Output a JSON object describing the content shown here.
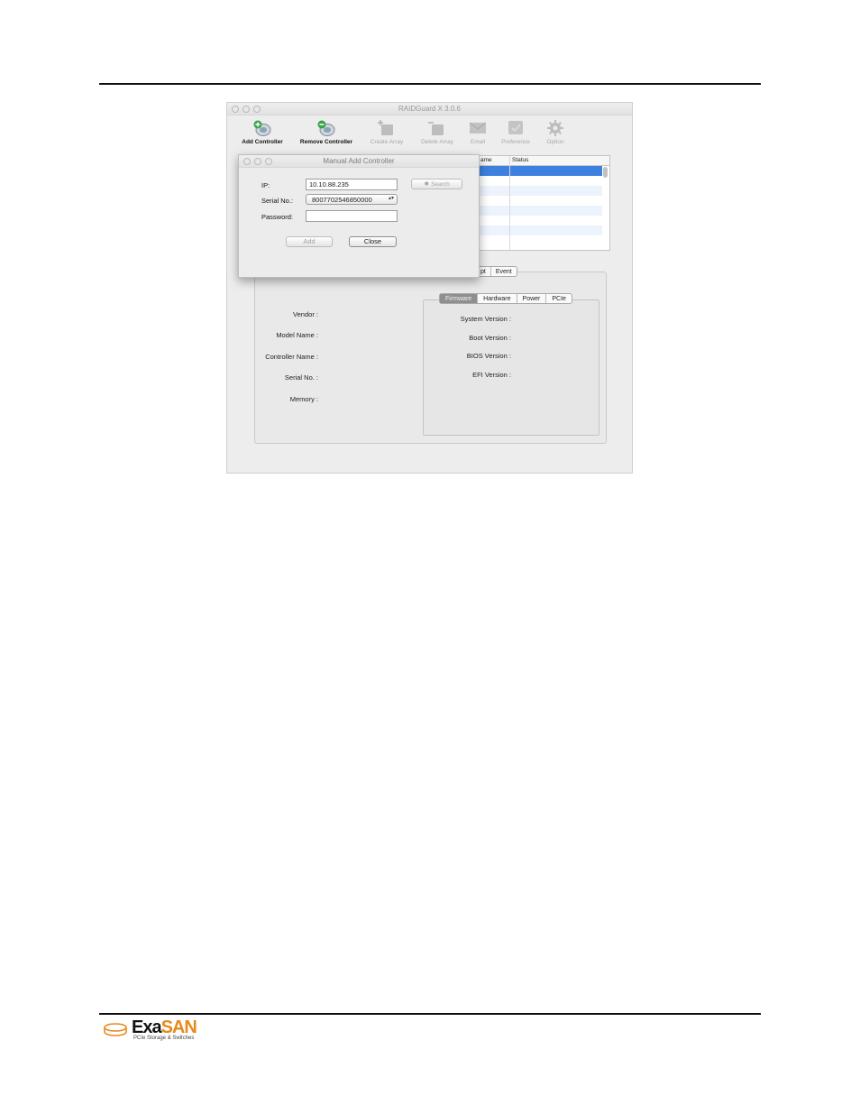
{
  "window": {
    "title": "RAIDGuard X 3.0.6"
  },
  "toolbar": {
    "items": [
      {
        "label": "Add Controller",
        "icon": "add-controller-icon",
        "state": "active"
      },
      {
        "label": "Remove Controller",
        "icon": "remove-controller-icon",
        "state": "active"
      },
      {
        "label": "Create Array",
        "icon": "create-array-icon",
        "state": "disabled"
      },
      {
        "label": "Delete Array",
        "icon": "delete-array-icon",
        "state": "disabled"
      },
      {
        "label": "Email",
        "icon": "email-icon",
        "state": "disabled"
      },
      {
        "label": "Preference",
        "icon": "preference-icon",
        "state": "disabled"
      },
      {
        "label": "Option",
        "icon": "gear-icon",
        "state": "disabled"
      }
    ]
  },
  "list": {
    "columns": [
      "ame",
      "Status"
    ]
  },
  "info_tabs": [
    "pt",
    "Event"
  ],
  "controller_info": {
    "labels": [
      "Vendor :",
      "Model Name :",
      "Controller Name :",
      "Serial No. :",
      "Memory :"
    ]
  },
  "version_tabs": [
    {
      "label": "Firmware",
      "selected": true
    },
    {
      "label": "Hardware",
      "selected": false
    },
    {
      "label": "Power",
      "selected": false
    },
    {
      "label": "PCIe",
      "selected": false
    }
  ],
  "version_info": {
    "labels": [
      "System Version :",
      "Boot Version :",
      "BIOS Version :",
      "EFI Version :"
    ]
  },
  "dialog": {
    "title": "Manual Add Controller",
    "ip_label": "IP:",
    "ip_value": "10.10.88.235",
    "serial_label": "Serial No.:",
    "serial_value": "8007702546850000",
    "password_label": "Password:",
    "password_value": "",
    "search_label": "Search",
    "add_label": "Add",
    "close_label": "Close"
  },
  "footer": {
    "logo_exa": "Exa",
    "logo_san": "SAN",
    "logo_sub": "PCIe Storage & Switches"
  },
  "colors": {
    "selection": "#3d80df",
    "brand_orange": "#e8891c",
    "tab_selected": "#8f8f8f"
  }
}
